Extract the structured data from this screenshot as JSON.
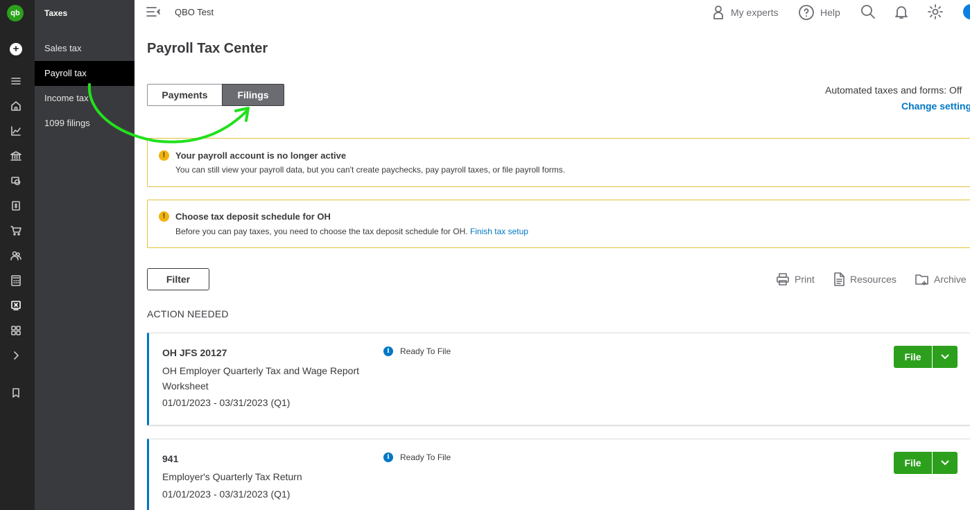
{
  "rail": {
    "logo_text": "qb",
    "new_symbol": "+",
    "icons": [
      "menu-icon",
      "home-icon",
      "chart-icon",
      "bank-icon",
      "expenses-icon",
      "sales-icon",
      "cart-icon",
      "people-icon",
      "calculator-icon",
      "taxes-icon",
      "apps-icon",
      "chevron-right-icon",
      "bookmark-icon"
    ]
  },
  "subnav": {
    "title": "Taxes",
    "items": [
      {
        "label": "Sales tax"
      },
      {
        "label": "Payroll tax"
      },
      {
        "label": "Income tax"
      },
      {
        "label": "1099 filings"
      }
    ]
  },
  "topbar": {
    "company": "QBO Test",
    "my_experts": "My experts",
    "help": "Help"
  },
  "page": {
    "title": "Payroll Tax Center",
    "tabs": [
      {
        "label": "Payments"
      },
      {
        "label": "Filings"
      }
    ],
    "automated_label": "Automated taxes and forms: Off",
    "change_setting": "Change setting"
  },
  "alerts": [
    {
      "heading": "Your payroll account is no longer active",
      "body": "You can still view your payroll data, but you can't create paychecks, pay payroll taxes, or file payroll forms."
    },
    {
      "heading": "Choose tax deposit schedule for OH",
      "body": "Before you can pay taxes, you need to choose the tax deposit schedule for OH.",
      "link": "Finish tax setup"
    }
  ],
  "toolbar": {
    "filter": "Filter",
    "print": "Print",
    "resources": "Resources",
    "archive": "Archive"
  },
  "section_heading": "ACTION NEEDED",
  "filings": [
    {
      "code": "OH JFS 20127",
      "name": "OH Employer Quarterly Tax and Wage Report Worksheet",
      "period": "01/01/2023 - 03/31/2023 (Q1)",
      "status": "Ready To File",
      "action": "File"
    },
    {
      "code": "941",
      "name": "Employer's Quarterly Tax Return",
      "period": "01/01/2023 - 03/31/2023 (Q1)",
      "status": "Ready To File",
      "action": "File"
    }
  ],
  "colors": {
    "brand_green": "#2ca01c",
    "link_blue": "#0077c5",
    "sidebar_dark": "#393a3d",
    "rail_dark": "#242424",
    "annotation_green": "#22e01e"
  }
}
